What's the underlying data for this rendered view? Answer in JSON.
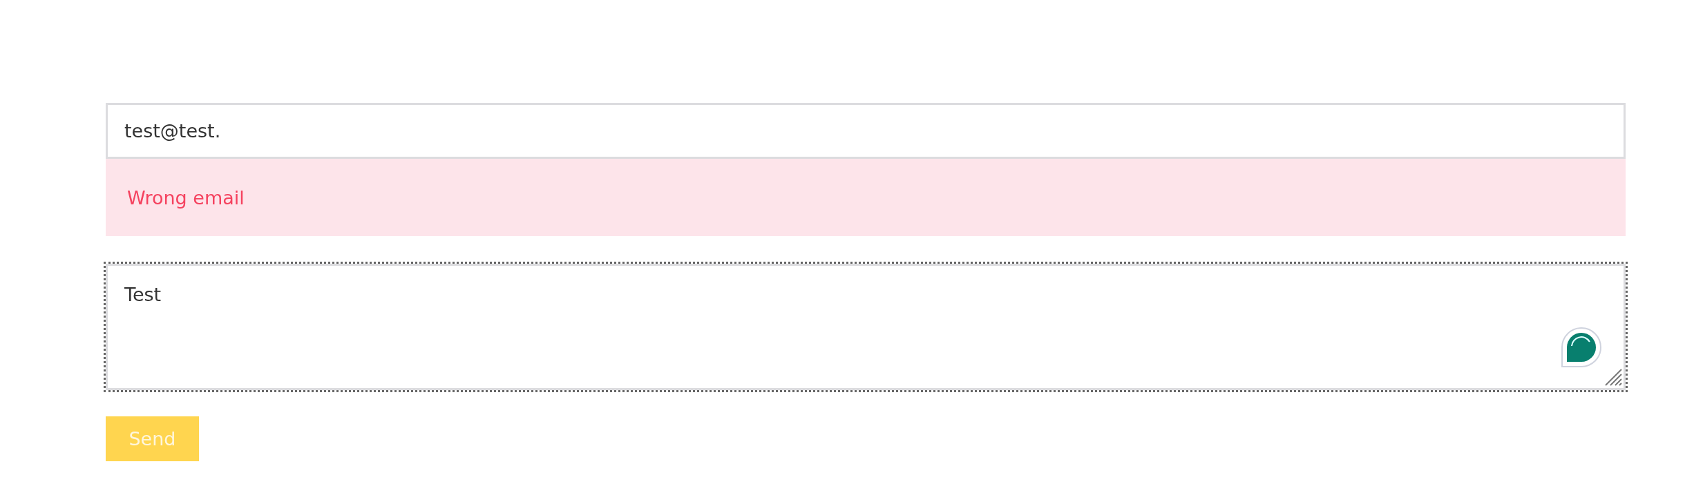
{
  "email_field": {
    "value": "test@test.",
    "invalid": true
  },
  "error_message": "Wrong email",
  "message_field": {
    "value": "Test",
    "focused": true
  },
  "send_button": {
    "label": "Send",
    "disabled": true
  }
}
